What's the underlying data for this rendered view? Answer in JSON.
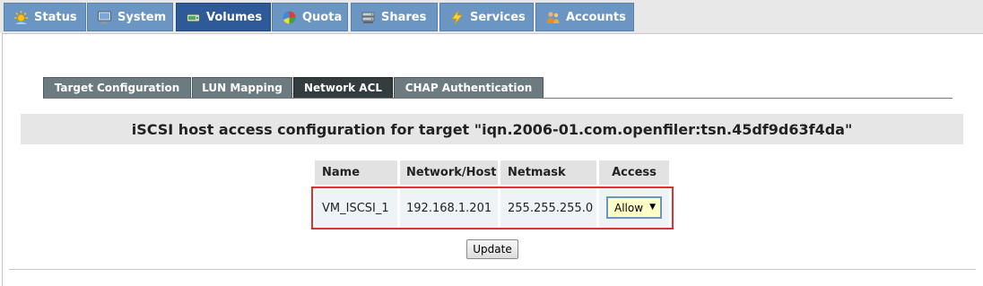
{
  "nav": {
    "tabs": [
      {
        "label": "Status",
        "icon": "sun-icon"
      },
      {
        "label": "System",
        "icon": "computer-icon"
      },
      {
        "label": "Volumes",
        "icon": "drive-icon",
        "active": true
      },
      {
        "label": "Quota",
        "icon": "pie-chart-icon"
      },
      {
        "label": "Shares",
        "icon": "server-icon"
      },
      {
        "label": "Services",
        "icon": "lightning-icon"
      },
      {
        "label": "Accounts",
        "icon": "users-icon"
      }
    ]
  },
  "subtabs": [
    {
      "label": "Target Configuration"
    },
    {
      "label": "LUN Mapping"
    },
    {
      "label": "Network ACL",
      "active": true
    },
    {
      "label": "CHAP Authentication"
    }
  ],
  "banner": {
    "title": "iSCSI host access configuration for target \"iqn.2006-01.com.openfiler:tsn.45df9d63f4da\""
  },
  "acl_table": {
    "headers": [
      "Name",
      "Network/Host",
      "Netmask",
      "Access"
    ],
    "rows": [
      {
        "name": "VM_ISCSI_1",
        "network": "192.168.1.201",
        "netmask": "255.255.255.0",
        "access": "Allow"
      }
    ]
  },
  "update_button": {
    "label": "Update"
  },
  "colors": {
    "nav_tab": "#6b96c4",
    "nav_tab_active": "#2f5a9a",
    "subtab": "#6b7b7f",
    "subtab_active": "#333c3e",
    "highlight": "#e0302f",
    "select_bg": "#ffffc8"
  }
}
